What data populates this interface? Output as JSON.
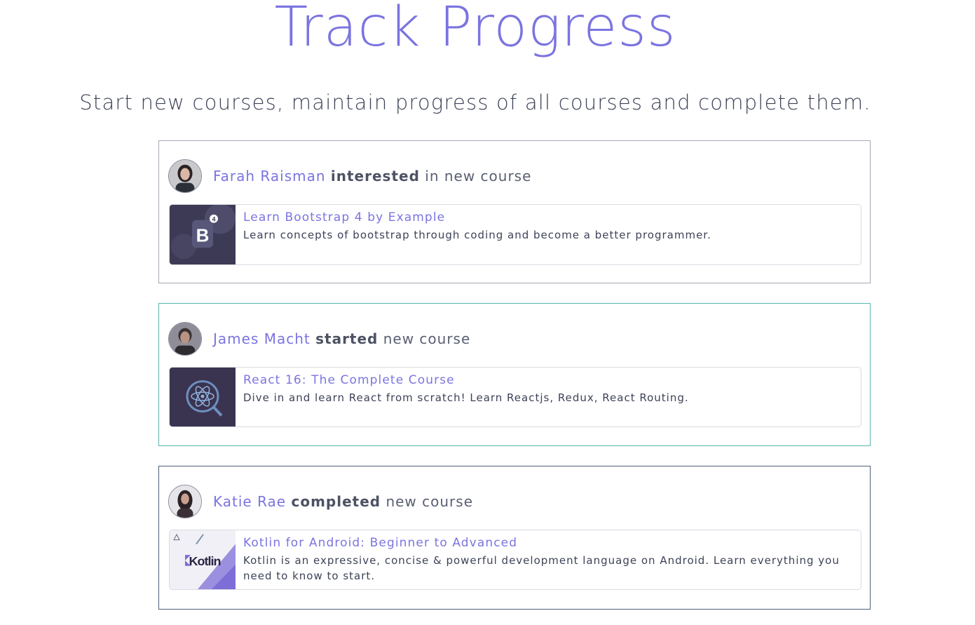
{
  "hero": {
    "title": "Track Progress",
    "subtitle": "Start new courses, maintain progress of all courses and complete them."
  },
  "colors": {
    "accent": "#7b74e0",
    "text": "#3d4257",
    "card1_border": "#a4a8b4",
    "card2_border": "#5bb3ae",
    "card3_border": "#4f6078"
  },
  "feed": [
    {
      "user": "Farah Raisman",
      "verb": "interested",
      "suffix": "in new course",
      "course": {
        "title": "Learn Bootstrap 4 by Example",
        "description": "Learn concepts of bootstrap through coding and become a better programmer.",
        "thumbnail": "bootstrap-thumbnail"
      }
    },
    {
      "user": "James Macht",
      "verb": "started",
      "suffix": "new course",
      "course": {
        "title": "React 16: The Complete Course",
        "description": "Dive in and learn React from scratch! Learn Reactjs, Redux, React Routing.",
        "thumbnail": "react-thumbnail"
      }
    },
    {
      "user": "Katie Rae",
      "verb": "completed",
      "suffix": "new course",
      "course": {
        "title": "Kotlin for Android: Beginner to Advanced",
        "description": "Kotlin is an expressive, concise & powerful development language on Android. Learn everything you need to know to start.",
        "thumbnail": "kotlin-thumbnail",
        "thumbnail_text": "Kotlin"
      }
    }
  ]
}
